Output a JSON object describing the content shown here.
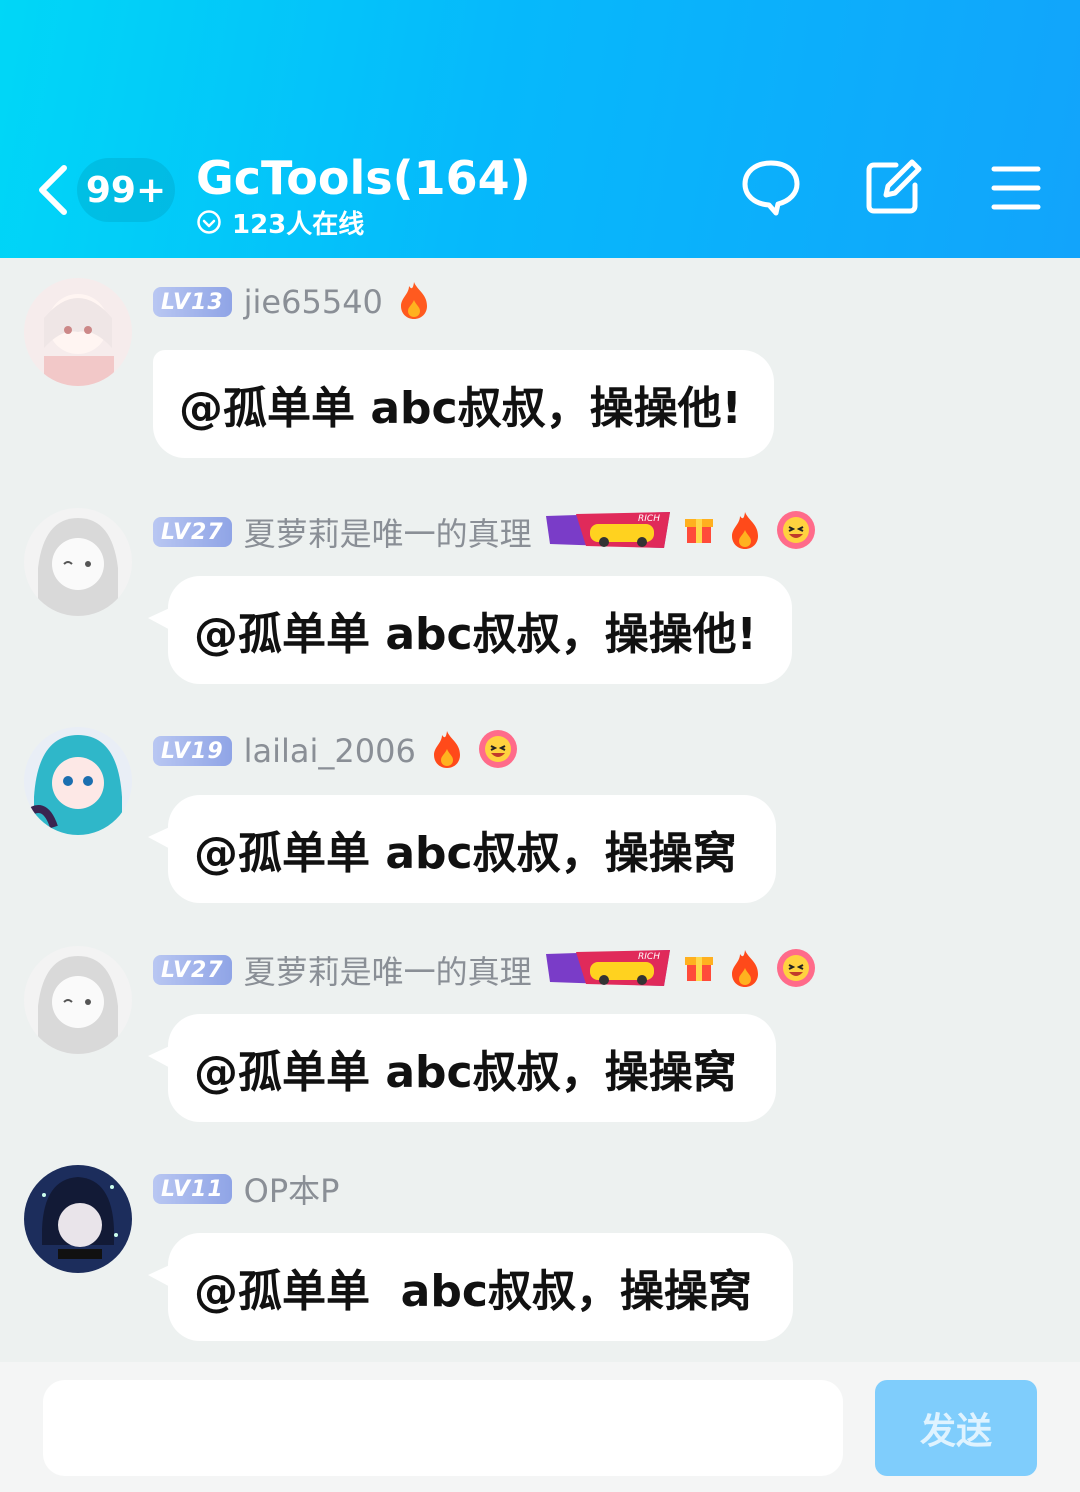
{
  "header": {
    "unread": "99+",
    "title": "GcTools(164)",
    "online": "123人在线",
    "back_icon": "chevron-left-icon",
    "chat_icon": "chat-bubble-icon",
    "edit_icon": "edit-icon",
    "menu_icon": "menu-icon"
  },
  "messages": [
    {
      "level": "LV13",
      "nickname": "jie65540",
      "text": "@孤单单 abc叔叔，操操他!",
      "badges": [
        "fire-icon"
      ]
    },
    {
      "level": "LV27",
      "nickname": "夏萝莉是唯一的真理",
      "text": "@孤单单 abc叔叔，操操他!",
      "badges": [
        "rich-car-badge",
        "gift-box-icon",
        "fire-icon",
        "laughing-flower-icon"
      ]
    },
    {
      "level": "LV19",
      "nickname": "lailai_2006",
      "text": "@孤单单 abc叔叔，操操窝",
      "badges": [
        "fire-icon",
        "laughing-flower-icon"
      ]
    },
    {
      "level": "LV27",
      "nickname": "夏萝莉是唯一的真理",
      "text": "@孤单单 abc叔叔，操操窝",
      "badges": [
        "rich-car-badge",
        "gift-box-icon",
        "fire-icon",
        "laughing-flower-icon"
      ]
    },
    {
      "level": "LV11",
      "nickname": "OP本P",
      "text": "@孤单单  abc叔叔，操操窝",
      "badges": []
    }
  ],
  "rich_label": "RICH",
  "input": {
    "value": "",
    "placeholder": ""
  },
  "send_label": "发送",
  "colors": {
    "header_start": "#00d7f7",
    "header_end": "#12a4fb",
    "send_button": "#7fcdfc",
    "background": "#edf1f0"
  }
}
